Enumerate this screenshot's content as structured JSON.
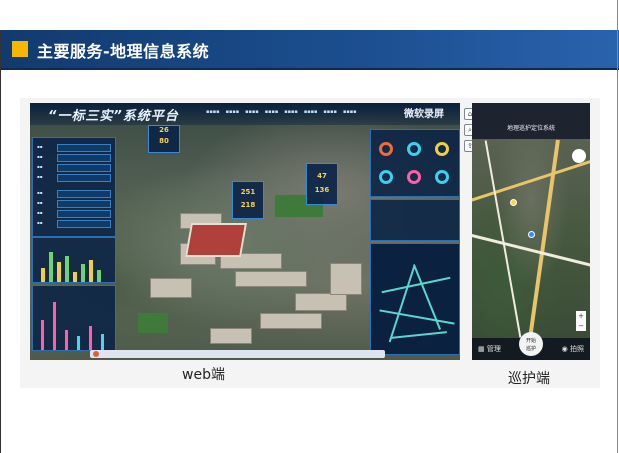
{
  "slide": {
    "title": "主要服务-地理信息系统",
    "accent_color": "#f5b700",
    "header_color": "#1c4f91"
  },
  "web_app": {
    "platform_title": "“一标三实”系统平台",
    "top_right_text": "微软录屏",
    "panel_values": {
      "top_card_1": "26",
      "top_card_2": "80",
      "mid_card_1": "251",
      "mid_card_2": "218",
      "right_card_1": "47",
      "right_card_2": "136"
    },
    "icons": [
      "search-icon",
      "share-icon",
      "home-icon"
    ]
  },
  "mobile_app": {
    "app_title": "地理巡护定位系统",
    "bottom_left": "管理",
    "bottom_center": "开始\n巡护",
    "bottom_right": "拍照"
  },
  "captions": {
    "web": "web端",
    "mobile": "巡护端"
  }
}
